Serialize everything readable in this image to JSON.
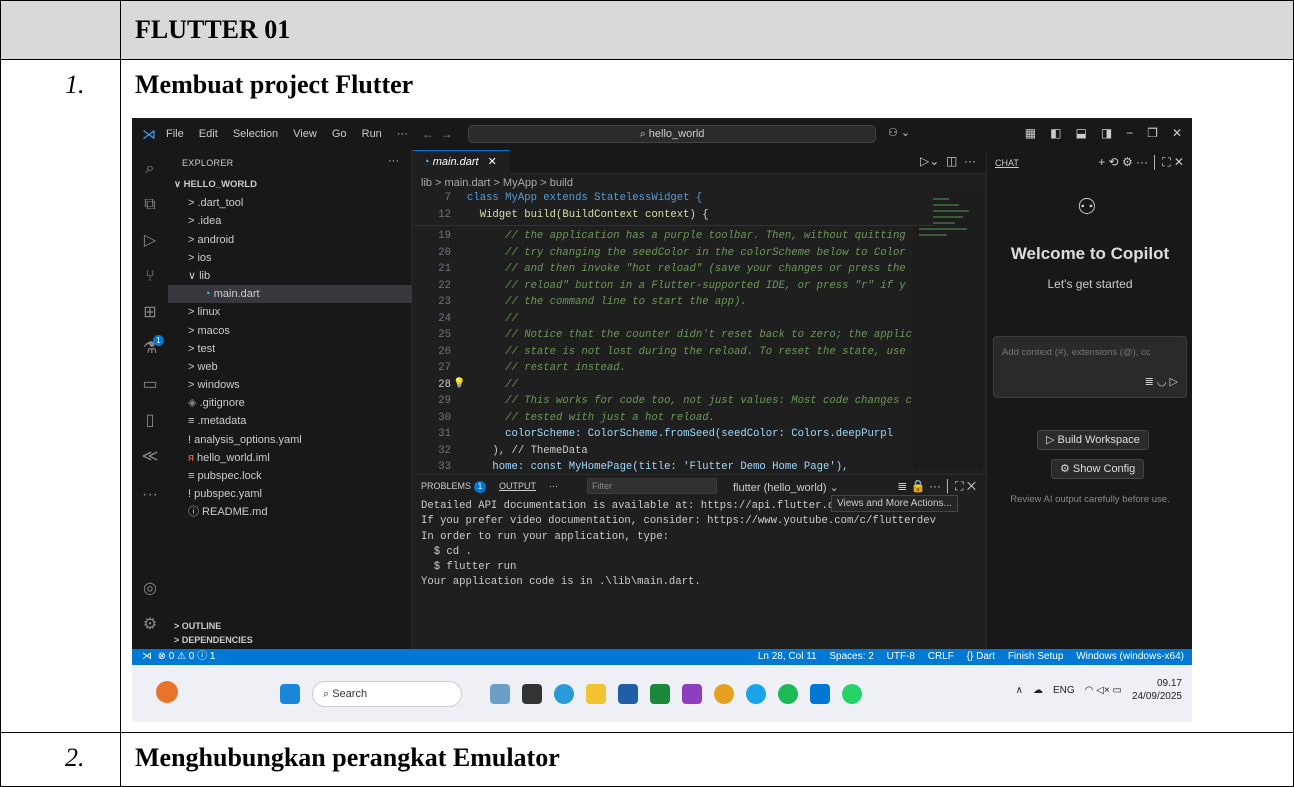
{
  "doc": {
    "header": "FLUTTER 01",
    "rows": [
      {
        "num": "1.",
        "title": "Membuat project Flutter"
      },
      {
        "num": "2.",
        "title": "Menghubungkan perangkat Emulator"
      }
    ]
  },
  "vscode": {
    "menu": [
      "File",
      "Edit",
      "Selection",
      "View",
      "Go",
      "Run",
      "···"
    ],
    "search": "hello_world",
    "explorer": {
      "heading": "EXPLORER",
      "root": "HELLO_WORLD",
      "items": [
        {
          "label": "> .dart_tool",
          "depth": 1
        },
        {
          "label": "> .idea",
          "depth": 1
        },
        {
          "label": "> android",
          "depth": 1
        },
        {
          "label": "> ios",
          "depth": 1
        },
        {
          "label": "∨ lib",
          "depth": 1
        },
        {
          "label": "main.dart",
          "depth": 2,
          "selected": true
        },
        {
          "label": "> linux",
          "depth": 1
        },
        {
          "label": "> macos",
          "depth": 1
        },
        {
          "label": "> test",
          "depth": 1
        },
        {
          "label": "> web",
          "depth": 1
        },
        {
          "label": "> windows",
          "depth": 1
        },
        {
          "label": ".gitignore",
          "depth": 1
        },
        {
          "label": "≡ .metadata",
          "depth": 1
        },
        {
          "label": "! analysis_options.yaml",
          "depth": 1
        },
        {
          "label": "hello_world.iml",
          "depth": 1
        },
        {
          "label": "≡ pubspec.lock",
          "depth": 1
        },
        {
          "label": "! pubspec.yaml",
          "depth": 1
        },
        {
          "label": "ⓘ README.md",
          "depth": 1
        }
      ],
      "outline": "> OUTLINE",
      "dependencies": "> DEPENDENCIES"
    },
    "tab": "main.dart",
    "breadcrumb": "lib > main.dart > MyApp > build",
    "sticky": [
      {
        "n": "7",
        "t": "class MyApp extends StatelessWidget {"
      },
      {
        "n": "12",
        "t": "  Widget build(BuildContext context) {"
      }
    ],
    "lines": [
      {
        "n": "19",
        "t": "      // the application has a purple toolbar. Then, without quitting"
      },
      {
        "n": "20",
        "t": "      // try changing the seedColor in the colorScheme below to Color"
      },
      {
        "n": "21",
        "t": "      // and then invoke \"hot reload\" (save your changes or press the"
      },
      {
        "n": "22",
        "t": "      // reload\" button in a Flutter-supported IDE, or press \"r\" if y"
      },
      {
        "n": "23",
        "t": "      // the command line to start the app)."
      },
      {
        "n": "24",
        "t": "      //"
      },
      {
        "n": "25",
        "t": "      // Notice that the counter didn't reset back to zero; the applic"
      },
      {
        "n": "26",
        "t": "      // state is not lost during the reload. To reset the state, use"
      },
      {
        "n": "27",
        "t": "      // restart instead."
      },
      {
        "n": "28",
        "t": "      //"
      },
      {
        "n": "29",
        "t": "      // This works for code too, not just values: Most code changes c"
      },
      {
        "n": "30",
        "t": "      // tested with just a hot reload."
      },
      {
        "n": "31",
        "t": "      colorScheme: ColorScheme.fromSeed(seedColor: Colors.deepPurpl"
      },
      {
        "n": "32",
        "t": "    ), // ThemeData"
      },
      {
        "n": "33",
        "t": "    home: const MyHomePage(title: 'Flutter Demo Home Page'),"
      }
    ],
    "panel": {
      "problems": "PROBLEMS",
      "problems_count": "1",
      "output": "OUTPUT",
      "filter": "Filter",
      "select": "flutter (hello_world)",
      "tooltip": "Views and More Actions...",
      "lines": [
        "Detailed API documentation is available at: https://api.flutter.de",
        "If you prefer video documentation, consider: https://www.youtube.com/c/flutterdev",
        "",
        "In order to run your application, type:",
        "",
        "  $ cd .",
        "  $ flutter run",
        "",
        "Your application code is in .\\lib\\main.dart."
      ]
    },
    "chat": {
      "heading": "CHAT",
      "welcome": "Welcome to Copilot",
      "started": "Let's get started",
      "placeholder": "Add context (#), extensions (@), cc",
      "build": "Build Workspace",
      "config": "Show Config",
      "review": "Review AI output carefully before use."
    },
    "status": {
      "left": "⊗ 0 ⚠ 0 ⓘ 1",
      "items": [
        "Ln 28, Col 11",
        "Spaces: 2",
        "UTF-8",
        "CRLF",
        "{} Dart",
        "Finish Setup",
        "Windows (windows-x64)"
      ]
    },
    "taskbar": {
      "search": "Search",
      "lang": "ENG",
      "time": "09.17",
      "date": "24/09/2025"
    }
  }
}
